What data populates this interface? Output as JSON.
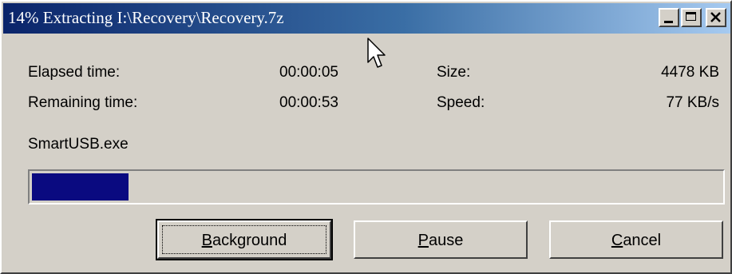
{
  "window": {
    "title": "14% Extracting I:\\Recovery\\Recovery.7z",
    "controls": {
      "minimize": "minimize-icon",
      "maximize": "maximize-icon",
      "close": "close-icon"
    }
  },
  "stats": {
    "elapsed_label": "Elapsed time:",
    "elapsed_value": "00:00:05",
    "remaining_label": "Remaining time:",
    "remaining_value": "00:00:53",
    "size_label": "Size:",
    "size_value": "4478 KB",
    "speed_label": "Speed:",
    "speed_value": "77 KB/s"
  },
  "current_file": "SmartUSB.exe",
  "progress": {
    "fraction": 0.14,
    "fill_color": "#0a0a80"
  },
  "buttons": {
    "background": {
      "accel": "B",
      "rest": "ackground"
    },
    "pause": {
      "accel": "P",
      "rest": "ause"
    },
    "cancel": {
      "accel": "C",
      "rest": "ancel"
    }
  },
  "colors": {
    "titlebar_start": "#0a246a",
    "titlebar_end": "#a6caf0",
    "face": "#d4d0c8"
  }
}
